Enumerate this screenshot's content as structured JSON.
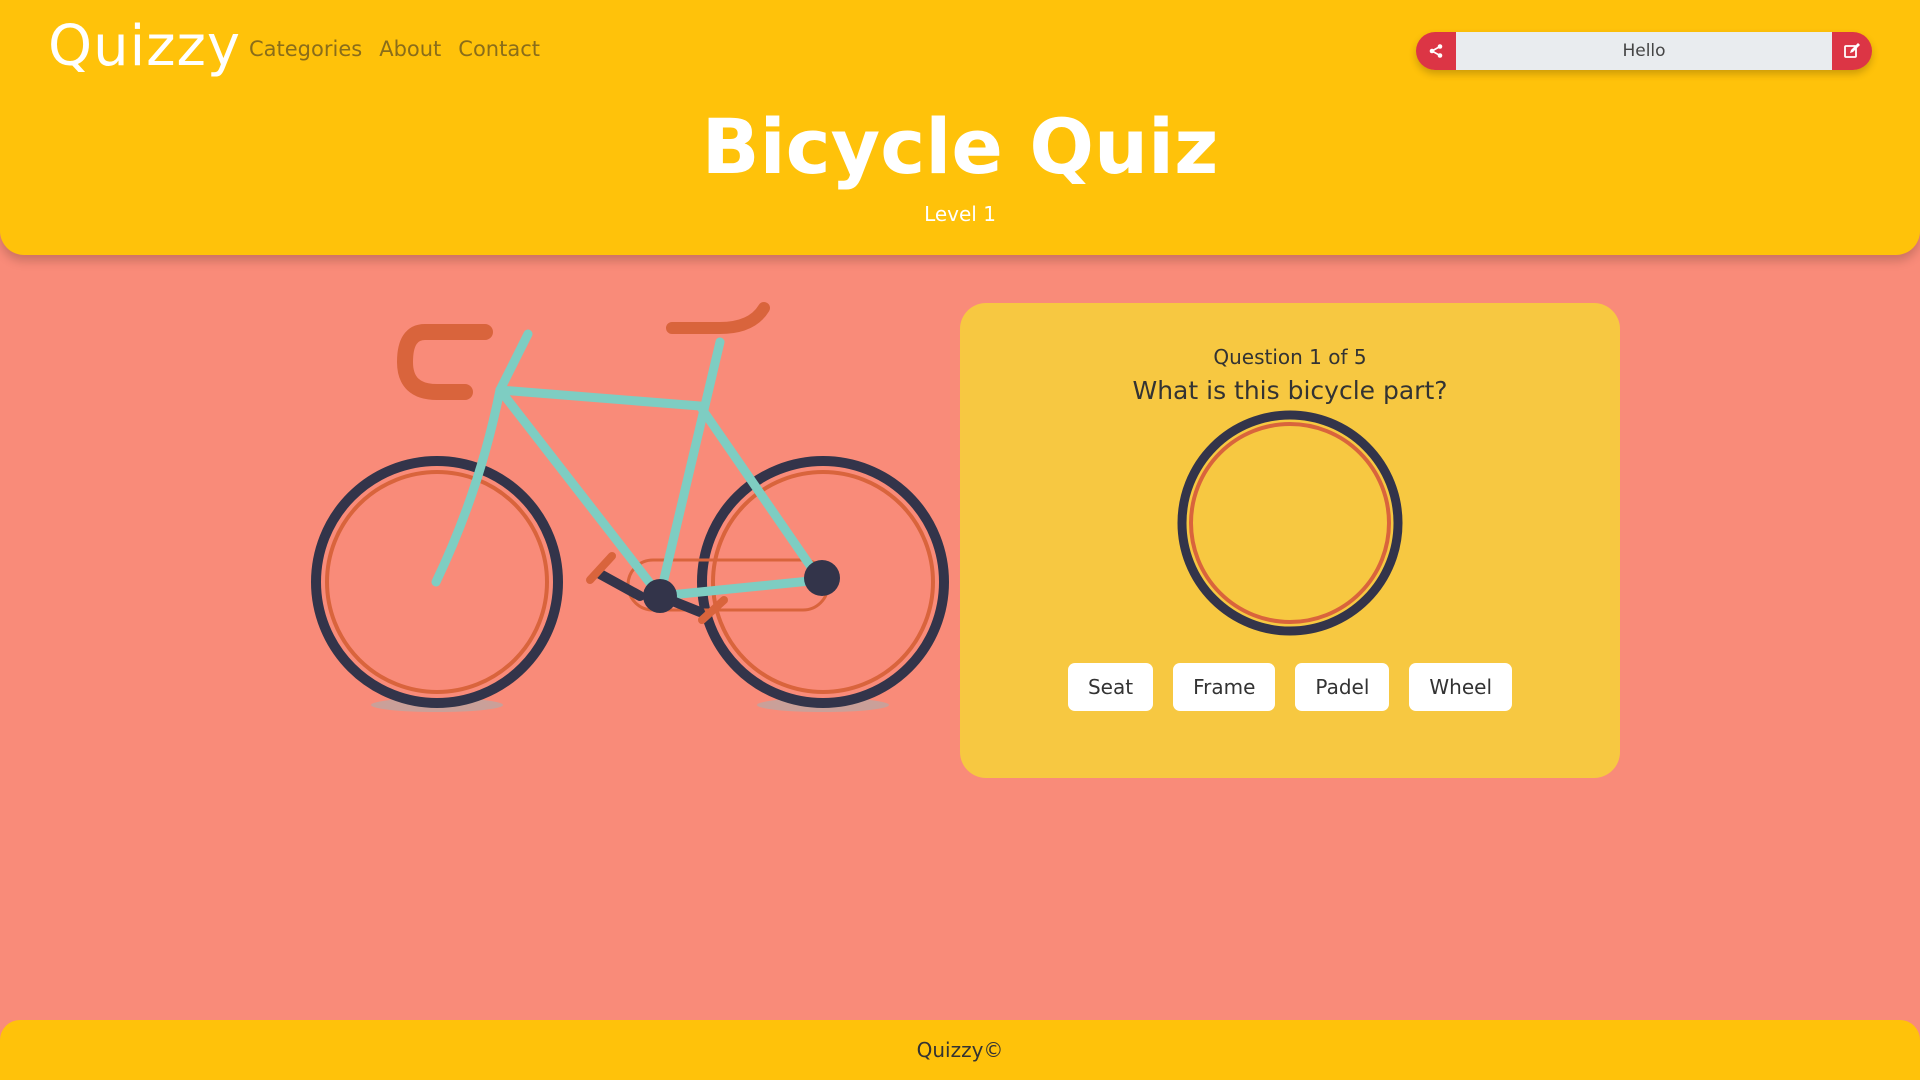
{
  "brand": "Quizzy",
  "nav": [
    "Categories",
    "About",
    "Contact"
  ],
  "greeting": {
    "text": "Hello",
    "left_icon": "share-icon",
    "right_icon": "edit-icon"
  },
  "title": "Bicycle Quiz",
  "subtitle": "Level 1",
  "quiz": {
    "progress": "Question 1 of 5",
    "question": "What is this bicycle part?",
    "answers": [
      "Seat",
      "Frame",
      "Padel",
      "Wheel"
    ]
  },
  "footer": "Quizzy©",
  "colors": {
    "header": "#ffc20a",
    "background": "#f98b79",
    "card": "#f7c841",
    "frame": "#7ecdc2",
    "accent": "#d9643c",
    "tire": "#33344a",
    "button_red": "#dc3545"
  }
}
